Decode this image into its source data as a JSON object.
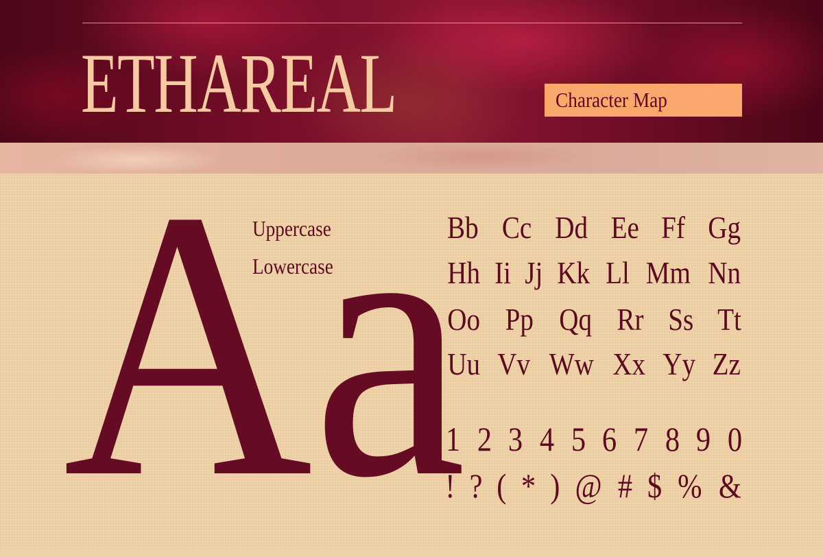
{
  "header": {
    "title": "ETHAREAL",
    "badge_label": "Character Map"
  },
  "specimen": {
    "big_letters": "Aa",
    "uppercase_label": "Uppercase",
    "lowercase_label": "Lowercase"
  },
  "glyph_rows": [
    [
      "Bb",
      "Cc",
      "Dd",
      "Ee",
      "Ff",
      "Gg"
    ],
    [
      "Hh",
      "Ii",
      "Jj",
      "Kk",
      "Ll",
      "Mm",
      "Nn"
    ],
    [
      "Oo",
      "Pp",
      "Qq",
      "Rr",
      "Ss",
      "Tt"
    ],
    [
      "Uu",
      "Vv",
      "Ww",
      "Xx",
      "Yy",
      "Zz"
    ],
    [
      "1",
      "2",
      "3",
      "4",
      "5",
      "6",
      "7",
      "8",
      "9",
      "0"
    ],
    [
      "!",
      "?",
      "(",
      "*",
      ")",
      "@",
      "#",
      "$",
      "%",
      "&"
    ]
  ],
  "colors": {
    "burgundy": "#650c24",
    "peach_title": "#f6caa3",
    "badge_orange": "#f9a76d",
    "background_sand": "#efd2a9"
  }
}
